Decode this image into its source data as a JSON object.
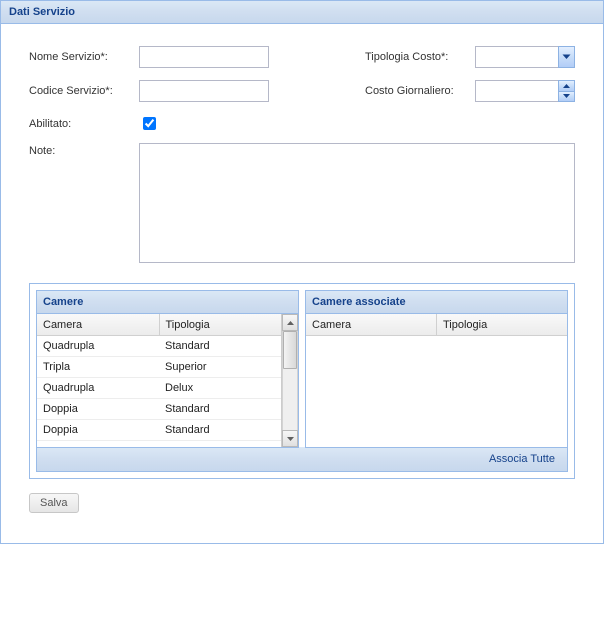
{
  "panel": {
    "title": "Dati Servizio"
  },
  "form": {
    "nomeServizioLabel": "Nome Servizio*:",
    "nomeServizioValue": "",
    "tipologiaCostoLabel": "Tipologia Costo*:",
    "tipologiaCostoValue": "",
    "codiceServizioLabel": "Codice Servizio*:",
    "codiceServizioValue": "",
    "costoGiornalieroLabel": "Costo Giornaliero:",
    "costoGiornalieroValue": "",
    "abilitatoLabel": "Abilitato:",
    "noteLabel": "Note:",
    "noteValue": ""
  },
  "camere": {
    "title": "Camere",
    "col1": "Camera",
    "col2": "Tipologia",
    "rows": [
      {
        "c1": "Quadrupla",
        "c2": "Standard"
      },
      {
        "c1": "Tripla",
        "c2": "Superior"
      },
      {
        "c1": "Quadrupla",
        "c2": "Delux"
      },
      {
        "c1": "Doppia",
        "c2": "Standard"
      },
      {
        "c1": "Doppia",
        "c2": "Standard"
      }
    ]
  },
  "camereAssociate": {
    "title": "Camere associate",
    "col1": "Camera",
    "col2": "Tipologia"
  },
  "assocTutte": "Associa Tutte",
  "saveLabel": "Salva"
}
